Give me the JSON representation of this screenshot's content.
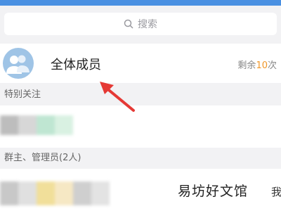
{
  "search": {
    "placeholder": "搜索",
    "icon": "search-icon"
  },
  "all_members": {
    "label": "全体成员",
    "remaining_prefix": "剩余",
    "remaining_count": "10",
    "remaining_suffix": "次",
    "avatar_icon": "group-avatar-icon"
  },
  "sections": {
    "special": "特别关注",
    "admins": "群主、管理员(2人)"
  },
  "watermark": {
    "text": "易坊好文馆",
    "tail": "我"
  },
  "colors": {
    "accent": "#4a90e2",
    "count": "#f0972a",
    "arrow": "#e53935"
  }
}
